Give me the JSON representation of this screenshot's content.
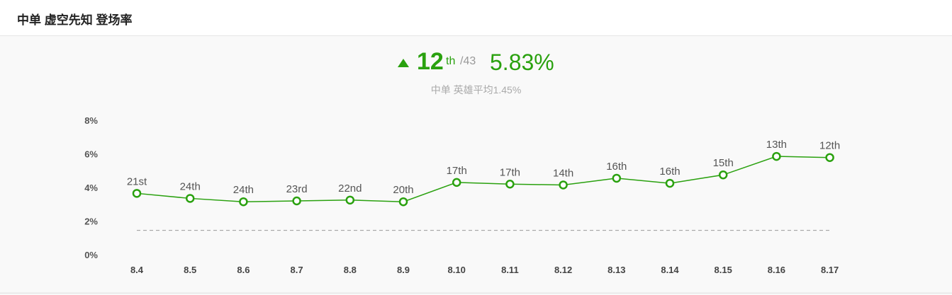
{
  "header": {
    "title": "中单 虚空先知 登场率"
  },
  "summary": {
    "rank": "12",
    "rank_suffix": "th",
    "rank_total": "/43",
    "rate": "5.83%",
    "average_text": "中单 英雄平均1.45%"
  },
  "colors": {
    "accent": "#2aa10f",
    "average_line": "#999999",
    "text_muted": "#aaaaaa"
  },
  "chart_data": {
    "type": "line",
    "x": [
      "8.4",
      "8.5",
      "8.6",
      "8.7",
      "8.8",
      "8.9",
      "8.10",
      "8.11",
      "8.12",
      "8.13",
      "8.14",
      "8.15",
      "8.16",
      "8.17"
    ],
    "series": [
      {
        "values": [
          3.65,
          3.35,
          3.15,
          3.2,
          3.25,
          3.15,
          4.3,
          4.2,
          4.15,
          4.55,
          4.25,
          4.75,
          5.85,
          5.78
        ],
        "labels": [
          "21st",
          "24th",
          "24th",
          "23rd",
          "22nd",
          "20th",
          "17th",
          "17th",
          "14th",
          "16th",
          "16th",
          "15th",
          "13th",
          "12th"
        ]
      }
    ],
    "average": 1.45,
    "yticks": [
      "0%",
      "2%",
      "4%",
      "6%",
      "8%"
    ],
    "ylim": [
      0,
      8
    ],
    "grid": false,
    "legend": "none"
  }
}
